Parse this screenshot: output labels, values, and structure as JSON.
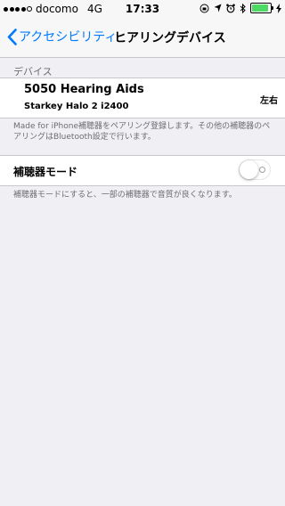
{
  "status_bar": {
    "carrier": "docomo",
    "network": "4G",
    "time": "17:33",
    "battery_level": 0.9,
    "signal_bars": 4,
    "battery_color": "#4cd964"
  },
  "nav": {
    "back_label": "アクセシビリティ",
    "title": "ヒアリングデバイス",
    "accent_color": "#007aff"
  },
  "devices_section": {
    "header": "デバイス",
    "device": {
      "name": "5050 Hearing Aids",
      "model": "Starkey Halo 2 i2400",
      "side": "左右"
    },
    "footer": "Made for iPhone補聴器をペアリング登録します。その他の補聴器のペアリングはBluetooth設定で行います。"
  },
  "hearing_aid_mode": {
    "label": "補聴器モード",
    "enabled": false,
    "footer": "補聴器モードにすると、一部の補聴器で音質が良くなります。"
  }
}
